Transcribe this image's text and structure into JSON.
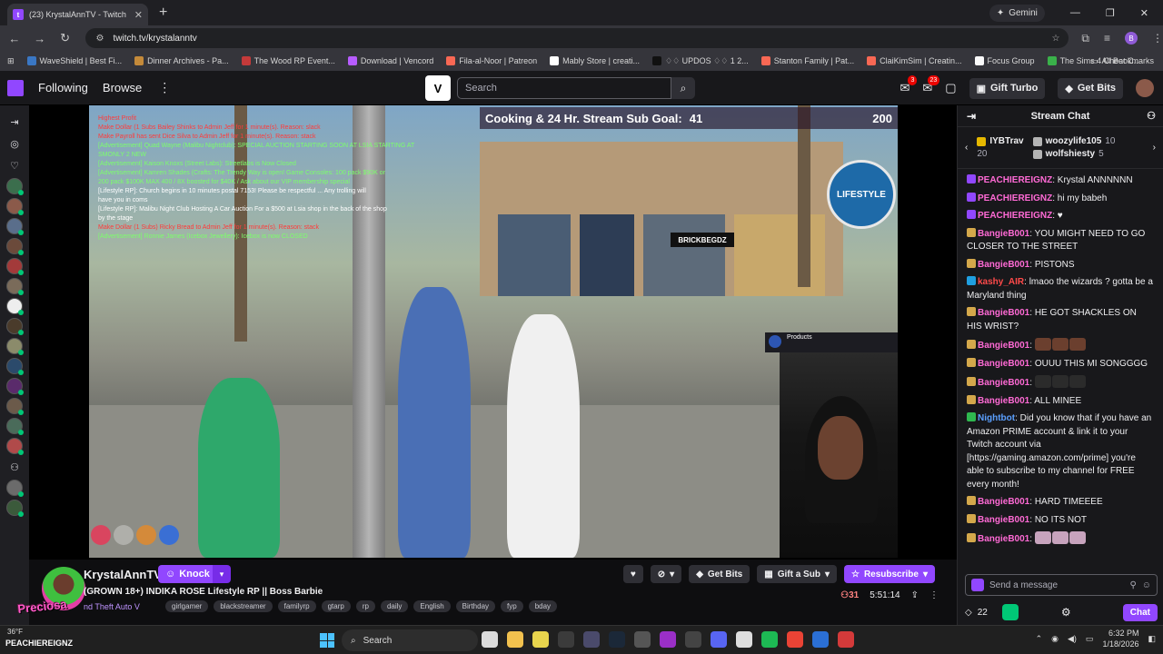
{
  "browser": {
    "tab_title": "(23) KrystalAnnTV - Twitch",
    "gemini_label": "Gemini",
    "url": "twitch.tv/krystalanntv",
    "profile_initial": "B",
    "bookmarks": [
      "WaveShield | Best Fi...",
      "Dinner Archives - Pa...",
      "The Wood RP Event...",
      "Download | Vencord",
      "Fila-al-Noor | Patreon",
      "Mably Store | creati...",
      "♢♢ UPDOS ♢♢ 1 2...",
      "Stanton Family | Pat...",
      "ClaiKimSim | Creatin...",
      "Focus Group",
      "The Sims 4 Cheat C..."
    ],
    "all_bookmarks_label": "All Bookmarks"
  },
  "twitch_nav": {
    "following_label": "Following",
    "browse_label": "Browse",
    "search_placeholder": "Search",
    "inbox_badge": "3",
    "notif_badge": "23",
    "gift_turbo_label": "Gift Turbo",
    "get_bits_label": "Get Bits"
  },
  "video": {
    "goal_text": "Cooking & 24 Hr. Stream Sub Goal:",
    "goal_current": "41",
    "goal_target": "200",
    "logo_text": "LIFESTYLE",
    "shop_sign": "BRICKBEGDZ",
    "products_label": "Products",
    "overlay_lines": [
      {
        "text": "Highest Profit",
        "color": "#ff3b3b"
      },
      {
        "text": "Make Dollar (1 Subs Bailey Shinks to Admin Jeff for 1 minute(s). Reason: slack",
        "color": "#ff3b3b"
      },
      {
        "text": "Make Payroll has sent Dice Silva to Admin Jeff for 1 minute(s). Reason: stack",
        "color": "#ff3b3b"
      },
      {
        "text": "[Advertisement] Quad Wayne (Malibu Nightclub): SPECIAL AUCTION STARTING SOON AT LSIA STARTING AT",
        "color": "#7cff6b"
      },
      {
        "text": "SMONLY 2 NEW",
        "color": "#7cff6b"
      },
      {
        "text": "[Advertisement] Kaison Knoxs (Street Labs): Streetlabs is Now Closed",
        "color": "#7cff6b"
      },
      {
        "text": "[Advertisement] Kamren Shades (Crafts: The Trendy Way is open! Game Consoles: 100 pack $90K or",
        "color": "#7cff6b"
      },
      {
        "text": "200 pack $100K MAX 400 / 8X boosted for $40K / Ask about our VIP membership special",
        "color": "#7cff6b"
      },
      {
        "text": "[Lifestyle RP]: Church begins in 10 minutes postal 7153! Please be respectful ... Any trolling will",
        "color": "#ffffff"
      },
      {
        "text": "have you in coms",
        "color": "#ffffff"
      },
      {
        "text": "[Lifestyle RP]: Malibu Night Club Hosting A Car Auction For a $500 at Lsia shop in the back of the shop",
        "color": "#ffffff"
      },
      {
        "text": "by the stage",
        "color": "#ffffff"
      },
      {
        "text": "Make Dollar (1 Subs) Ricky Bread to Admin Jeff for 1 minute(s). Reason: stack",
        "color": "#ff3b3b"
      },
      {
        "text": "[Advertisement] Ronnie James (Icebox Jewellery): Icebox is now CLOSED",
        "color": "#7cff6b"
      }
    ]
  },
  "stream": {
    "streamer_name": "KrystalAnnTV",
    "overlay_name": "Preciosa",
    "knock_label": "Knock",
    "title": "(GROWN 18+) INDIKA ROSE Lifestyle RP || Boss Barbie",
    "category": "nd Theft Auto V",
    "tags": [
      "girlgamer",
      "blackstreamer",
      "familyrp",
      "gtarp",
      "rp",
      "daily",
      "English",
      "Birthday",
      "fyp",
      "bday"
    ],
    "get_bits_label": "Get Bits",
    "gift_sub_label": "Gift a Sub",
    "resubscribe_label": "Resubscribe",
    "viewers": "31",
    "uptime": "5:51:14"
  },
  "chat": {
    "header": "Stream Chat",
    "gifters": [
      {
        "name": "IYBTrav",
        "count": "20"
      },
      {
        "name": "woozylife105",
        "count": "10"
      },
      {
        "name": "wolfshiesty",
        "count": "5"
      }
    ],
    "messages": [
      {
        "user": "PEACHIEREIGNZ",
        "color": "#ff6ad5",
        "badge": "#9147ff",
        "text": "Krystal ANNNNNN"
      },
      {
        "user": "PEACHIEREIGNZ",
        "color": "#ff6ad5",
        "badge": "#9147ff",
        "text": "hi my babeh"
      },
      {
        "user": "PEACHIEREIGNZ",
        "color": "#ff6ad5",
        "badge": "#9147ff",
        "text": "♥"
      },
      {
        "user": "BangieB001",
        "color": "#ff6ad5",
        "badge": "#d4a84b",
        "text": "YOU MIGHT NEED TO GO CLOSER TO THE STREET"
      },
      {
        "user": "BangieB001",
        "color": "#ff6ad5",
        "badge": "#d4a84b",
        "text": "PISTONS"
      },
      {
        "user": "kashy_AIR",
        "color": "#ff4a4a",
        "badge": "#1f9fe0",
        "text": "lmaoo the wizards ? gotta be a Maryland thing"
      },
      {
        "user": "BangieB001",
        "color": "#ff6ad5",
        "badge": "#d4a84b",
        "text": "HE GOT SHACKLES ON HIS WRIST?"
      },
      {
        "user": "BangieB001",
        "color": "#ff6ad5",
        "badge": "#d4a84b",
        "text": ""
      },
      {
        "user": "BangieB001",
        "color": "#ff6ad5",
        "badge": "#d4a84b",
        "text": "OUUU THIS MI SONGGGG"
      },
      {
        "user": "BangieB001",
        "color": "#ff6ad5",
        "badge": "#d4a84b",
        "text": ""
      },
      {
        "user": "BangieB001",
        "color": "#ff6ad5",
        "badge": "#d4a84b",
        "text": "ALL MINEE"
      },
      {
        "user": "Nightbot",
        "color": "#5ba0ff",
        "badge": "#2fb84f",
        "text": "Did you know that if you have an Amazon PRIME account & link it to your Twitch account via [https://gaming.amazon.com/prime] you're able to subscribe to my channel for FREE every month!"
      },
      {
        "user": "BangieB001",
        "color": "#ff6ad5",
        "badge": "#d4a84b",
        "text": "HARD TIMEEEE"
      },
      {
        "user": "BangieB001",
        "color": "#ff6ad5",
        "badge": "#d4a84b",
        "text": "NO ITS NOT"
      },
      {
        "user": "BangieB001",
        "color": "#ff6ad5",
        "badge": "#d4a84b",
        "text": ""
      }
    ],
    "input_placeholder": "Send a message",
    "points": "22",
    "chat_button": "Chat"
  },
  "taskbar": {
    "temperature": "36°F",
    "peachie_label": "PEACHIEREIGNZ",
    "search_label": "Search",
    "time": "6:32 PM",
    "date": "1/18/2026"
  }
}
